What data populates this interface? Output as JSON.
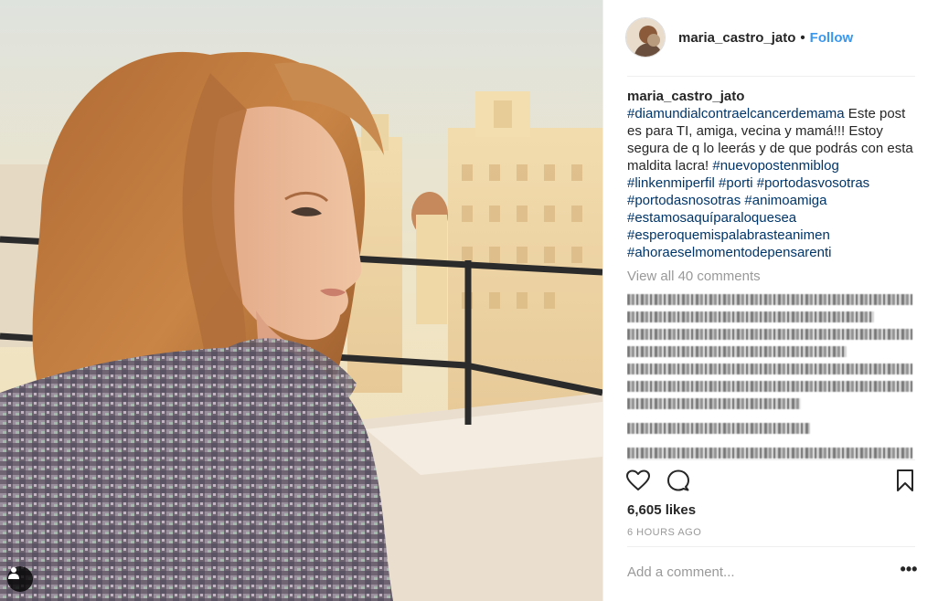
{
  "post": {
    "username": "maria_castro_jato",
    "separator": "•",
    "follow_label": "Follow"
  },
  "caption": {
    "username": "maria_castro_jato",
    "segments": [
      {
        "type": "tag",
        "text": "#diamundialcontraelcancerdemama"
      },
      {
        "type": "text",
        "text": " Este post es para TI, amiga, vecina y mamá!!! Estoy segura de q lo leerás y de que podrás con esta maldita lacra! "
      },
      {
        "type": "tag",
        "text": "#nuevopostenmiblog"
      },
      {
        "type": "text",
        "text": " "
      },
      {
        "type": "tag",
        "text": "#linkenmiperfil"
      },
      {
        "type": "text",
        "text": " "
      },
      {
        "type": "tag",
        "text": "#porti"
      },
      {
        "type": "text",
        "text": " "
      },
      {
        "type": "tag",
        "text": "#portodasvosotras"
      },
      {
        "type": "text",
        "text": " "
      },
      {
        "type": "tag",
        "text": "#portodasnosotras"
      },
      {
        "type": "text",
        "text": " "
      },
      {
        "type": "tag",
        "text": "#animoamiga"
      },
      {
        "type": "text",
        "text": " "
      },
      {
        "type": "tag",
        "text": "#estamosaquíparaloquesea"
      },
      {
        "type": "text",
        "text": " "
      },
      {
        "type": "tag",
        "text": "#esperoquemispalabrasteanimen"
      },
      {
        "type": "text",
        "text": " "
      },
      {
        "type": "tag",
        "text": "#ahoraeselmomentodepensarenti"
      }
    ]
  },
  "view_all_comments": "View all 40 comments",
  "likes": "6,605 likes",
  "timestamp": "6 HOURS AGO",
  "add_comment_placeholder": "Add a comment...",
  "more_options": "•••",
  "icons": {
    "like": "heart-icon",
    "comment": "comment-bubble-icon",
    "save": "bookmark-icon",
    "tagged_user": "user-tag-icon"
  },
  "colors": {
    "link_blue": "#3897f0",
    "hashtag": "#003569",
    "muted": "#999999"
  }
}
